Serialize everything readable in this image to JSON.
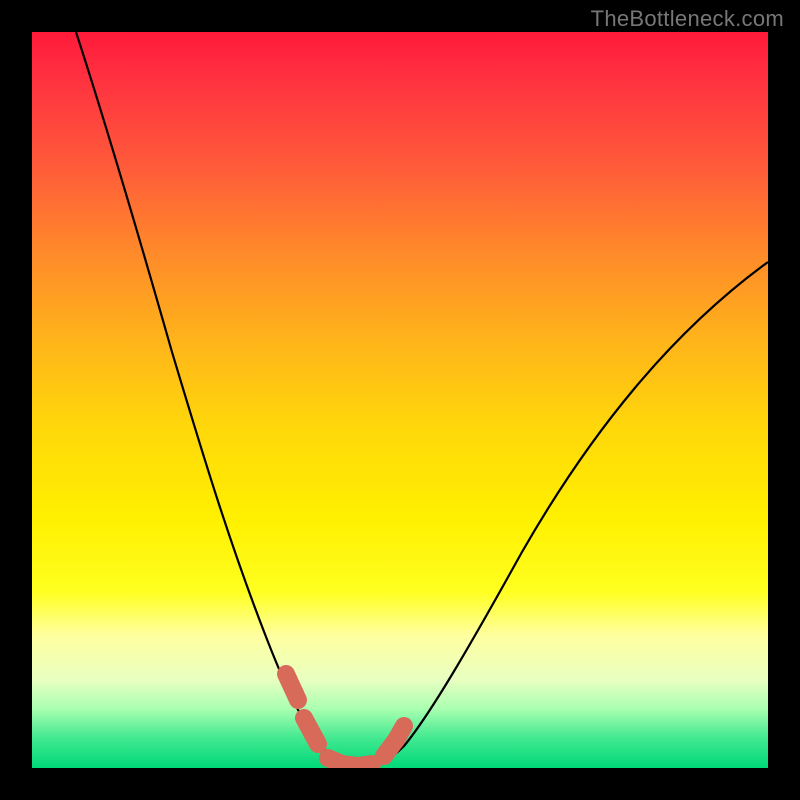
{
  "watermark": "TheBottleneck.com",
  "chart_data": {
    "type": "line",
    "title": "",
    "xlabel": "",
    "ylabel": "",
    "xlim": [
      0,
      100
    ],
    "ylim": [
      0,
      100
    ],
    "grid": false,
    "legend": false,
    "series": [
      {
        "name": "bottleneck-curve",
        "x": [
          6,
          10,
          14,
          18,
          22,
          26,
          30,
          34,
          36,
          38,
          40,
          42,
          44,
          46,
          50,
          56,
          62,
          70,
          80,
          90,
          100
        ],
        "y": [
          100,
          88,
          76,
          64,
          52,
          40,
          28,
          18,
          12,
          7,
          3,
          1,
          0,
          1,
          6,
          16,
          27,
          40,
          54,
          65,
          74
        ]
      },
      {
        "name": "optimal-range-marker",
        "x": [
          34,
          36,
          38,
          40,
          42,
          44,
          46,
          48
        ],
        "y": [
          16,
          11,
          6,
          3,
          1,
          0,
          1,
          5
        ]
      }
    ],
    "background_gradient": {
      "top": "#ff1a3a",
      "middle": "#fff000",
      "bottom": "#00d878"
    }
  }
}
